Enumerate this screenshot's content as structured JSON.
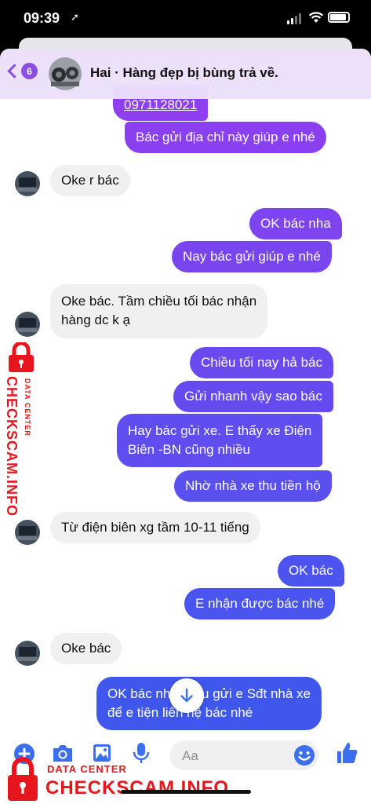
{
  "status_bar": {
    "time": "09:39",
    "location_glyph": "➚"
  },
  "header": {
    "back_count": "6",
    "title": "Hai · Hàng đẹp bị bùng trả về."
  },
  "messages": [
    {
      "dir": "out",
      "text": "0971128021",
      "link": true
    },
    {
      "dir": "out",
      "text": "Bác gửi địa chỉ này giúp e nhé"
    },
    {
      "dir": "in",
      "text": "Oke r bác"
    },
    {
      "dir": "out",
      "text": "OK bác nha"
    },
    {
      "dir": "out",
      "text": "Nay bác gửi giúp e nhé"
    },
    {
      "dir": "in",
      "lines": [
        "Oke bác. Tầm chiều tối bác nhận",
        "hàng dc k ạ"
      ]
    },
    {
      "dir": "out",
      "text": "Chiều tối nay hả bác"
    },
    {
      "dir": "out",
      "text": "Gửi nhanh vậy sao bác"
    },
    {
      "dir": "out",
      "lines": [
        "Hay bác gửi xe. E thấy xe Điện",
        "Biên -BN cũng nhiều"
      ]
    },
    {
      "dir": "out",
      "text": "Nhờ nhà xe thu tiền hộ"
    },
    {
      "dir": "in",
      "text": "Từ điện biên xg tầm 10-11 tiếng"
    },
    {
      "dir": "out",
      "text": "OK bác"
    },
    {
      "dir": "out",
      "text": "E nhận được bác nhé"
    },
    {
      "dir": "in",
      "text": "Oke bác"
    },
    {
      "dir": "out",
      "lines": [
        "OK bác nha. Sau gửi e Sđt nhà xe",
        "để e tiện liên hệ bác nhé"
      ]
    }
  ],
  "composer": {
    "placeholder": "Aa"
  },
  "icons": [
    "back-chevron-icon",
    "add-icon",
    "camera-icon",
    "gallery-icon",
    "microphone-icon",
    "emoji-icon",
    "like-icon",
    "scroll-down-arrow-icon",
    "lock-icon"
  ],
  "watermark": {
    "brand": "CHECKSCAM.INFO",
    "subtitle": "DATA CENTER"
  },
  "colors": {
    "accent": "#8a4fe0",
    "bubble_top": "#8c3ff0",
    "bubble_bottom": "#3f57ee",
    "incoming": "#f0f0f0",
    "watermark": "#e8151c"
  }
}
